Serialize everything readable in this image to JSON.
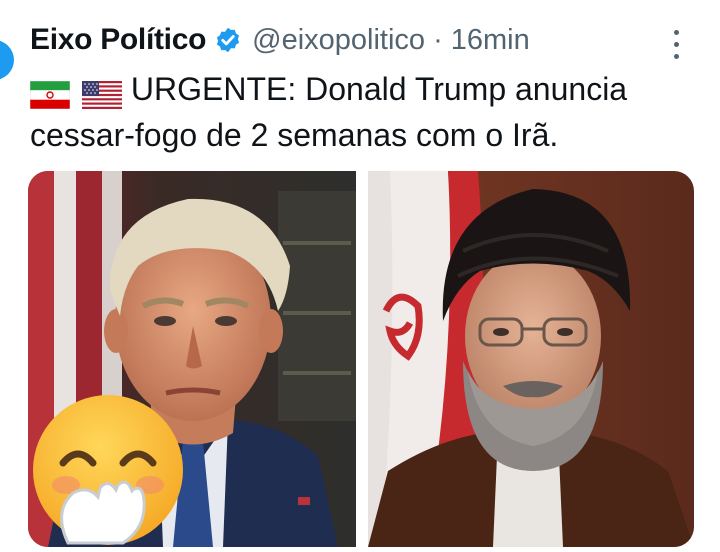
{
  "post": {
    "author_name": "Eixo Político",
    "handle": "@eixopolitico",
    "separator": "·",
    "time": "16min",
    "text": "URGENTE: Donald Trump anuncia cessar-fogo de 2 semanas com o Irã.",
    "flags": [
      "iran-flag",
      "usa-flag"
    ]
  },
  "media": {
    "photos": [
      "left-portrait-photo",
      "right-portrait-photo"
    ],
    "overlay": "face-with-hand-over-mouth-emoji"
  },
  "colors": {
    "name": "#0f1419",
    "secondary": "#536471",
    "verified": "#1d9bf0"
  }
}
